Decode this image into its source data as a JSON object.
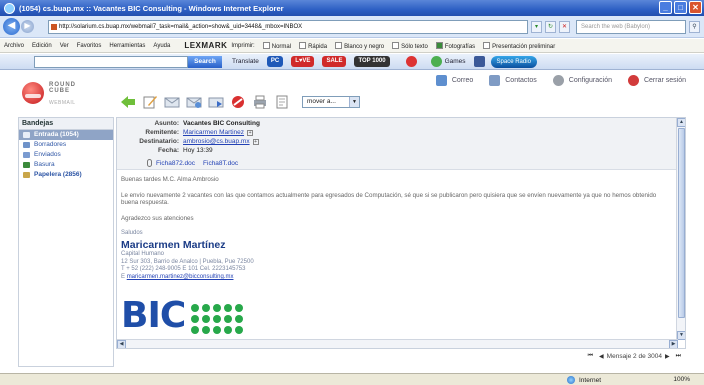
{
  "window": {
    "title": "(1054) cs.buap.mx :: Vacantes BIC Consulting - Windows Internet Explorer",
    "min": "_",
    "max": "□",
    "close": "✕"
  },
  "addressbar": {
    "url": "http://solarium.cs.buap.mx/webmail7_task=mail&_action=show&_uid=3448&_mbox=INBOX",
    "search_placeholder": "Search the web (Babylon)"
  },
  "menubar": {
    "items": [
      "Archivo",
      "Edición",
      "Ver",
      "Favoritos",
      "Herramientas",
      "Ayuda"
    ],
    "lexmark": "LEXMARK",
    "imprimir": "Imprimir:",
    "options": [
      "Normal",
      "Rápida",
      "Blanco y negro",
      "Sólo texto",
      "Fotografías",
      "Presentación preliminar"
    ]
  },
  "toolbar": {
    "search_button": "Search",
    "translate": "Translate",
    "pc": "PC",
    "love": "L♥VE",
    "sale": "SALE",
    "top": "TOP 1000",
    "games": "Games",
    "space_radio": "Space Radio"
  },
  "webmail": {
    "logo_top": "ROUND\nCUBE",
    "logo_bottom": "WEBMAIL",
    "nav": [
      {
        "label": "Correo",
        "color": "#5e8fcf"
      },
      {
        "label": "Contactos",
        "color": "#7f9bc4"
      },
      {
        "label": "Configuración",
        "color": "#9aa0a8"
      },
      {
        "label": "Cerrar sesión",
        "color": "#d23b3b"
      }
    ],
    "move_label": "mover a..."
  },
  "sidebar": {
    "title": "Bandejas",
    "folders": [
      {
        "label": "Entrada (1054)",
        "icon_color": "#e8eef8",
        "selected": true
      },
      {
        "label": "Borradores",
        "icon_color": "#6f93c9"
      },
      {
        "label": "Enviados",
        "icon_color": "#7a9bd0"
      },
      {
        "label": "Basura",
        "icon_color": "#3b8a3b"
      },
      {
        "label": "Papelera (2856)",
        "icon_color": "#c9a64a",
        "bold": true
      }
    ]
  },
  "message": {
    "labels": {
      "asunto": "Asunto:",
      "remitente": "Remitente:",
      "destinatario": "Destinatario:",
      "fecha": "Fecha:"
    },
    "asunto": "Vacantes BIC Consulting",
    "remitente": "Maricarmen Martinez",
    "destinatario": "ambrosio@cs.buap.mx",
    "fecha": "Hoy 13:39",
    "attachments": [
      "Ficha872.doc",
      "Ficha8T.doc"
    ],
    "greeting": "Buenas tardes M.C. Alma Ambrosio",
    "paragraph": "Le envío nuevamente 2 vacantes con las que contamos actualmente para egresados de Computación, sé que si se publicaron pero quisiera que se envíen nuevamente ya que no hemos obtenido buena respuesta.",
    "thanks": "Agradezco sus atenciones",
    "saludos": "Saludos",
    "sig_name": "Maricarmen Martínez",
    "sig_role": "Capital Humano",
    "sig_address": "12 Sur 303, Barrio de Analco | Puebla, Pue 72500",
    "sig_phone": "T + 52 (222) 248-9005 E 101 Cel. 2223145753",
    "sig_email_prefix": "E",
    "sig_email": "maricarmen.martinez@bicconsulting.mx",
    "bic_logo": "BIC"
  },
  "pager": {
    "text": "Mensaje 2 de 3004",
    "first": "⏮",
    "prev": "◀",
    "next": "▶",
    "last": "⏭"
  },
  "statusbar": {
    "zone": "Internet",
    "zoom": "100%"
  }
}
